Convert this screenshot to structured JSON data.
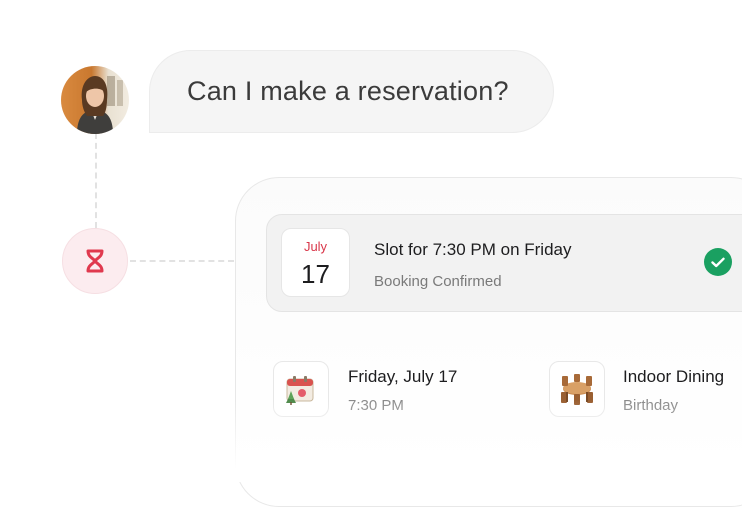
{
  "chat": {
    "message": "Can I make a reservation?"
  },
  "booking": {
    "month": "July",
    "day": "17",
    "slot_title": "Slot for 7:30 PM on Friday",
    "status": "Booking Confirmed",
    "details": [
      {
        "icon": "calendar-icon",
        "title": "Friday, July 17",
        "subtitle": "7:30 PM"
      },
      {
        "icon": "dining-table-icon",
        "title": "Indoor Dining",
        "subtitle": "Birthday"
      }
    ]
  },
  "colors": {
    "accent": "#e0394e",
    "success": "#1aa061",
    "bubble_bg": "#f5f5f5"
  }
}
